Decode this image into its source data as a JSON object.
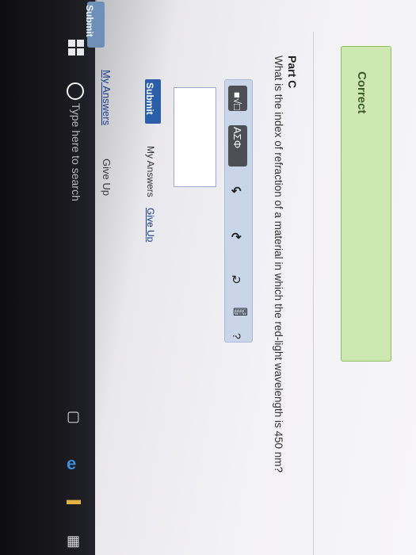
{
  "taskbar": {
    "search_placeholder": "Type here to search",
    "icons": [
      "windows-icon",
      "cortana-icon",
      "task-view-icon",
      "edge-icon",
      "file-explorer-icon",
      "store-icon"
    ]
  },
  "top_bar": {
    "submit_label": "Submit",
    "my_answers_label": "My Answers",
    "give_up_label": "Give Up"
  },
  "feedback": {
    "correct_label": "Correct"
  },
  "part_c": {
    "title": "Part C",
    "question": "What is the index of refraction of a material in which the red-light wavelength is 450 nm?",
    "toolbar": {
      "greek_label": "ΑΣΦ",
      "help_label": "?"
    },
    "answer_value": "",
    "submit_label": "Submit",
    "my_answers_label": "My Answers",
    "give_up_label": "Give Up"
  },
  "colors": {
    "submit_blue": "#2b5ea8",
    "correct_green": "#cde8b0",
    "link_blue": "#1a3f8f"
  }
}
